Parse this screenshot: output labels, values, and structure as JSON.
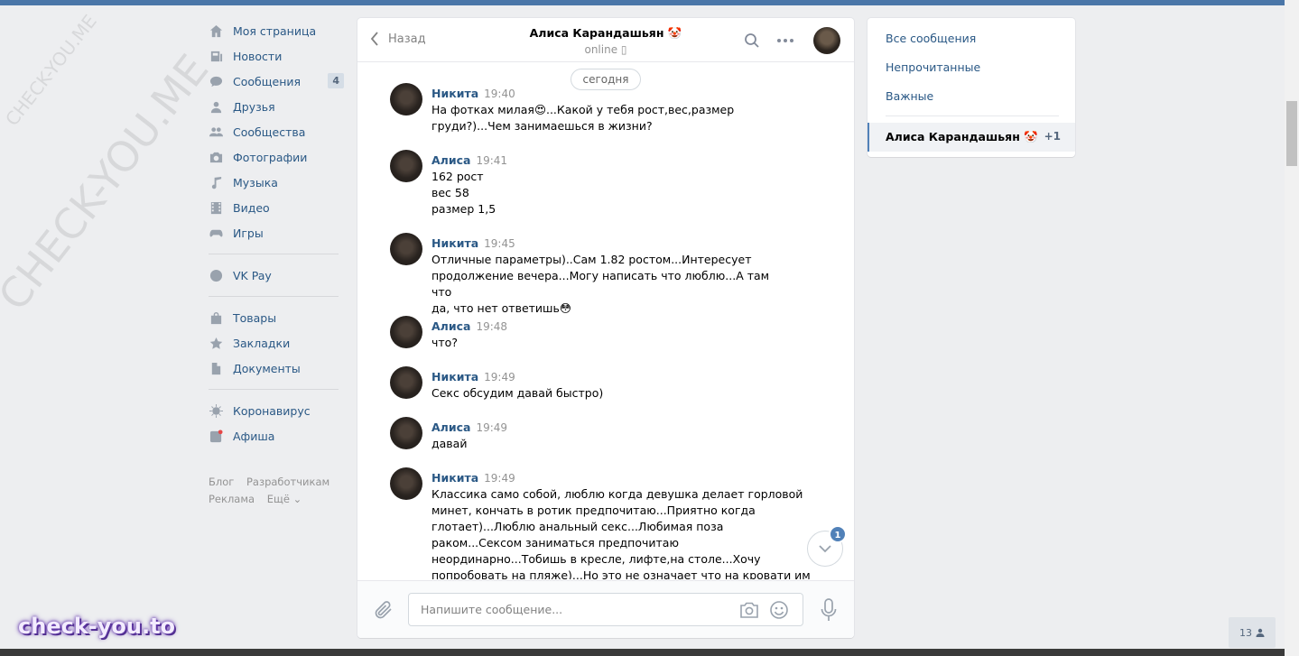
{
  "watermark_text": "CHECK-YOU.ME",
  "logo_text": "check-you.to",
  "nav": {
    "items": [
      {
        "label": "Моя страница",
        "icon": "home-icon"
      },
      {
        "label": "Новости",
        "icon": "news-icon"
      },
      {
        "label": "Сообщения",
        "icon": "messages-icon",
        "badge": "4"
      },
      {
        "label": "Друзья",
        "icon": "friends-icon"
      },
      {
        "label": "Сообщества",
        "icon": "groups-icon"
      },
      {
        "label": "Фотографии",
        "icon": "photos-icon"
      },
      {
        "label": "Музыка",
        "icon": "music-icon"
      },
      {
        "label": "Видео",
        "icon": "video-icon"
      },
      {
        "label": "Игры",
        "icon": "games-icon"
      }
    ],
    "pay": {
      "label": "VK Pay",
      "icon": "vkpay-icon"
    },
    "items2": [
      {
        "label": "Товары",
        "icon": "bag-icon"
      },
      {
        "label": "Закладки",
        "icon": "star-icon"
      },
      {
        "label": "Документы",
        "icon": "document-icon"
      }
    ],
    "items3": [
      {
        "label": "Коронавирус",
        "icon": "virus-icon"
      },
      {
        "label": "Афиша",
        "icon": "afisha-icon"
      }
    ],
    "footer": [
      "Блог",
      "Разработчикам",
      "Реклама",
      "Ещё ⌄"
    ]
  },
  "chat": {
    "back_label": "Назад",
    "peer_name": "Алиса Карандашьян 🤡",
    "peer_status": "online ▯",
    "date_label": "сегодня",
    "messages": [
      {
        "author": "Никита",
        "time": "19:40",
        "text": "На фотках милая😍...Какой у тебя рост,вес,размер\nгруди?)...Чем занимаешься в жизни?"
      },
      {
        "author": "Алиса",
        "time": "19:41",
        "text": "162 рост\nвес 58\nразмер 1,5"
      },
      {
        "author": "Никита",
        "time": "19:45",
        "text": "Отличные параметры)..Сам 1.82 ростом...Интересует\nпродолжение вечера...Могу написать что люблю...А там что\nда, что нет ответишь😳"
      },
      {
        "author": "Алиса",
        "time": "19:48",
        "text": "что?"
      },
      {
        "author": "Никита",
        "time": "19:49",
        "text": "Секс обсудим давай быстро)"
      },
      {
        "author": "Алиса",
        "time": "19:49",
        "text": "давай"
      },
      {
        "author": "Никита",
        "time": "19:49",
        "text": "Классика само собой, люблю когда девушка делает горловой\nминет, кончать в ротик предпочитаю...Приятно когда\nглотает)...Люблю анальный секс...Любимая поза\nраком...Сексом заниматься предпочитаю\nнеординарно...Тобишь в кресле, лифте,на столе...Хочу\nпопробовать на пляже)...Но это не означает что на кровати им"
      }
    ],
    "unread_badge": "1",
    "input_placeholder": "Напишите сообщение..."
  },
  "filters": {
    "all": "Все сообщения",
    "unread": "Непрочитанные",
    "important": "Важные",
    "active_name": "Алиса Карандашьян 🤡",
    "active_count": "+1"
  },
  "online_count": "13"
}
